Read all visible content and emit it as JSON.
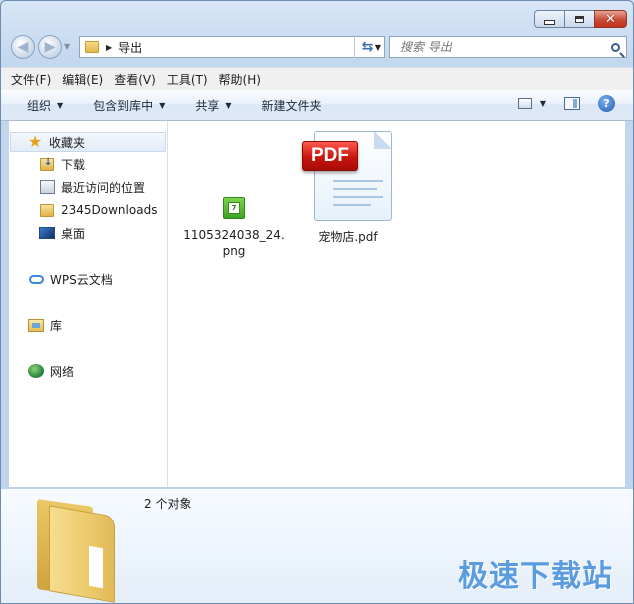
{
  "window": {
    "caption": {
      "minimize": "",
      "maximize": "",
      "close": "✕"
    }
  },
  "navigation": {
    "back_glyph": "◀",
    "forward_glyph": "▶",
    "address": {
      "crumb": "导出",
      "separator": "▶",
      "dropdown": "▼"
    },
    "refresh_glyph": "⇆",
    "search": {
      "placeholder": "搜索 导出"
    }
  },
  "menubar": {
    "items": [
      {
        "label": "文件(F)"
      },
      {
        "label": "编辑(E)"
      },
      {
        "label": "查看(V)"
      },
      {
        "label": "工具(T)"
      },
      {
        "label": "帮助(H)"
      }
    ]
  },
  "commandbar": {
    "organize": "组织",
    "include_in_library": "包含到库中",
    "share": "共享",
    "new_folder": "新建文件夹",
    "help": "?"
  },
  "navpane": {
    "favorites": "收藏夹",
    "downloads": "下载",
    "recent": "最近访问的位置",
    "downloads2345": "2345Downloads",
    "desktop": "桌面",
    "wps": "WPS云文档",
    "library": "库",
    "network": "网络"
  },
  "files": [
    {
      "name_line1": "1105324038_24.",
      "name_line2": "png",
      "icon": "png-image-icon",
      "badge": "7"
    },
    {
      "name_line1": "宠物店.pdf",
      "name_line2": "",
      "icon": "pdf-icon",
      "badge": "PDF"
    }
  ],
  "details": {
    "count": "2 个对象"
  },
  "watermark": "极速下载站",
  "colors": {
    "accent": "#3b88d8",
    "close_button": "#c74b34",
    "pdf_badge": "#c9150d",
    "png_icon": "#3ea322"
  }
}
